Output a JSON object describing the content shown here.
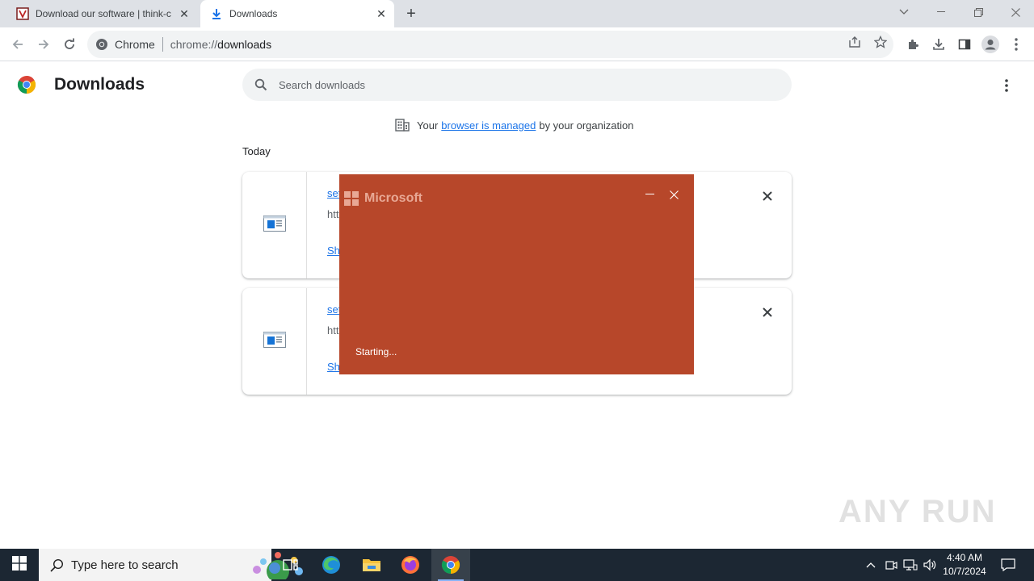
{
  "browser": {
    "tabs": [
      {
        "title": "Download our software | think-c",
        "active": false
      },
      {
        "title": "Downloads",
        "active": true
      }
    ],
    "omnibox": {
      "site_label": "Chrome",
      "url_host": "chrome://",
      "url_path": "downloads"
    }
  },
  "page": {
    "title": "Downloads",
    "search_placeholder": "Search downloads",
    "managed": {
      "prefix": "Your",
      "link": "browser is managed",
      "suffix": "by your organization"
    },
    "section_label": "Today",
    "downloads": [
      {
        "name_visible": "set",
        "url_visible": "htt",
        "action_visible": "Sh"
      },
      {
        "name_visible": "set",
        "url_visible": "htt",
        "action_visible": "Sh"
      }
    ]
  },
  "splash": {
    "brand": "Microsoft",
    "status": "Starting...",
    "background": "#b7472a"
  },
  "watermark": "ANY RUN",
  "taskbar": {
    "search_placeholder": "Type here to search",
    "time": "4:40 AM",
    "date": "10/7/2024",
    "apps": [
      "task-view",
      "edge",
      "file-explorer",
      "firefox",
      "chrome"
    ]
  }
}
